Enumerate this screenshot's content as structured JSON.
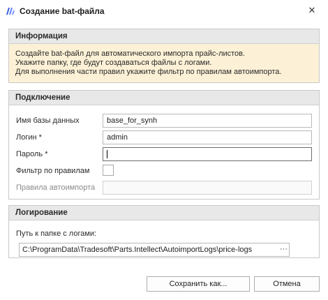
{
  "window": {
    "title": "Создание bat-файла",
    "close_glyph": "✕"
  },
  "info": {
    "header": "Информация",
    "lines": [
      "Создайте bat-файл для автоматического импорта прайс-листов.",
      "Укажите папку, где будут создаваться файлы с логами.",
      "Для выполнения части правил укажите фильтр по правилам автоимпорта."
    ]
  },
  "connection": {
    "header": "Подключение",
    "db_label": "Имя базы данных",
    "db_value": "base_for_synh",
    "login_label": "Логин *",
    "login_value": "admin",
    "password_label": "Пароль *",
    "password_value": "",
    "filter_label": "Фильтр по правилам",
    "filter_checked": false,
    "rules_label": "Правила автоимпорта",
    "rules_value": ""
  },
  "logging": {
    "header": "Логирование",
    "path_label": "Путь к папке с логами:",
    "path_value": "C:\\ProgramData\\Tradesoft\\Parts.Intellect\\AutoimportLogs\\price-logs",
    "browse_glyph": "···",
    "clear_glyph": "✕"
  },
  "buttons": {
    "save": "Сохранить как...",
    "cancel": "Отмена"
  },
  "colors": {
    "accent": "#3b5bdb",
    "info_bg": "#fcf1d6",
    "header_bg": "#e8e8e8",
    "clear": "#dd3333"
  }
}
